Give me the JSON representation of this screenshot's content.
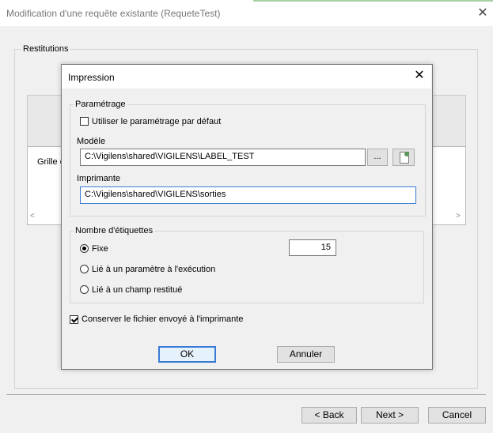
{
  "outer_window": {
    "title": "Modification d'une requête existante (RequeteTest)",
    "close_glyph": "✕",
    "restitutions_legend": "Restitutions",
    "grid_label": "Grille c",
    "scroll_left_glyph": "<",
    "scroll_right_glyph": ">",
    "back_label": "< Back",
    "next_label": "Next >",
    "cancel_label": "Cancel"
  },
  "dialog": {
    "title": "Impression",
    "close_glyph": "✕",
    "parametrage": {
      "legend": "Paramétrage",
      "use_default_label": "Utiliser le paramétrage par défaut",
      "use_default_checked": false,
      "modele_label": "Modèle",
      "modele_value": "C:\\Vigilens\\shared\\VIGILENS\\LABEL_TEST",
      "browse_label": "...",
      "imprimante_label": "Imprimante",
      "imprimante_value": "C:\\Vigilens\\shared\\VIGILENS\\sorties"
    },
    "nombre": {
      "legend": "Nombre d'étiquettes",
      "options": [
        {
          "label": "Fixe",
          "selected": true
        },
        {
          "label": "Lié à un paramètre à l'exécution",
          "selected": false
        },
        {
          "label": "Lié à un champ restitué",
          "selected": false
        }
      ],
      "count_value": "15"
    },
    "keep_file_label": "Conserver le fichier envoyé à l'imprimante",
    "keep_file_checked": true,
    "ok_label": "OK",
    "annuler_label": "Annuler"
  },
  "icons": {
    "preview": "document-preview-icon"
  }
}
